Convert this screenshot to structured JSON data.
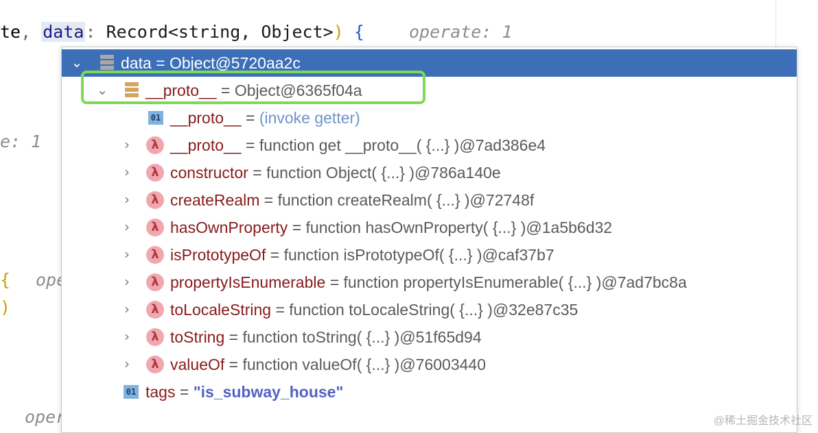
{
  "editor": {
    "line1": {
      "prefix": "te",
      "comma": ",",
      "param": "data",
      "colon": ":",
      "type": "Record<string, Object>",
      "paren": ")",
      "brace": "{",
      "inlay": "operate: 1"
    },
    "inlay_left_1": "e: 1",
    "fragment_brace": "{",
    "fragment_paren": ")",
    "inlay_ope": "ope",
    "inlay_oper": "oper"
  },
  "debugger": {
    "root": {
      "name": "data",
      "eq": "=",
      "value": "Object@5720aa2c"
    },
    "rows": [
      {
        "name": "__proto__",
        "eq": "=",
        "value": "Object@6365f04a"
      },
      {
        "name": "__proto__",
        "eq": "=",
        "value": "(invoke getter)"
      },
      {
        "name": "__proto__",
        "eq": "=",
        "value": "function get __proto__( {...} )@7ad386e4"
      },
      {
        "name": "constructor",
        "eq": "=",
        "value": "function Object( {...} )@786a140e"
      },
      {
        "name": "createRealm",
        "eq": "=",
        "value": "function createRealm( {...} )@72748f"
      },
      {
        "name": "hasOwnProperty",
        "eq": "=",
        "value": "function hasOwnProperty( {...} )@1a5b6d32"
      },
      {
        "name": "isPrototypeOf",
        "eq": "=",
        "value": "function isPrototypeOf( {...} )@caf37b7"
      },
      {
        "name": "propertyIsEnumerable",
        "eq": "=",
        "value": "function propertyIsEnumerable( {...} )@7ad7bc8a"
      },
      {
        "name": "toLocaleString",
        "eq": "=",
        "value": "function toLocaleString( {...} )@32e87c35"
      },
      {
        "name": "toString",
        "eq": "=",
        "value": "function toString( {...} )@51f65d94"
      },
      {
        "name": "valueOf",
        "eq": "=",
        "value": "function valueOf( {...} )@76003440"
      },
      {
        "name": "tags",
        "eq": "=",
        "value": "\"is_subway_house\""
      }
    ],
    "prim_badge": "01",
    "fn_badge": "λ",
    "expanded_chevron": "⌄",
    "collapsed_chevron": "›"
  },
  "watermark": "@稀土掘金技术社区",
  "colors": {
    "selected_row": "#3d6fb9",
    "highlight_border": "#7ed957",
    "property_name": "#871a1a",
    "string_value": "#5263c2"
  },
  "icons": {
    "object": "object-icon",
    "primitive": "primitive-icon",
    "function": "function-lambda-icon"
  }
}
